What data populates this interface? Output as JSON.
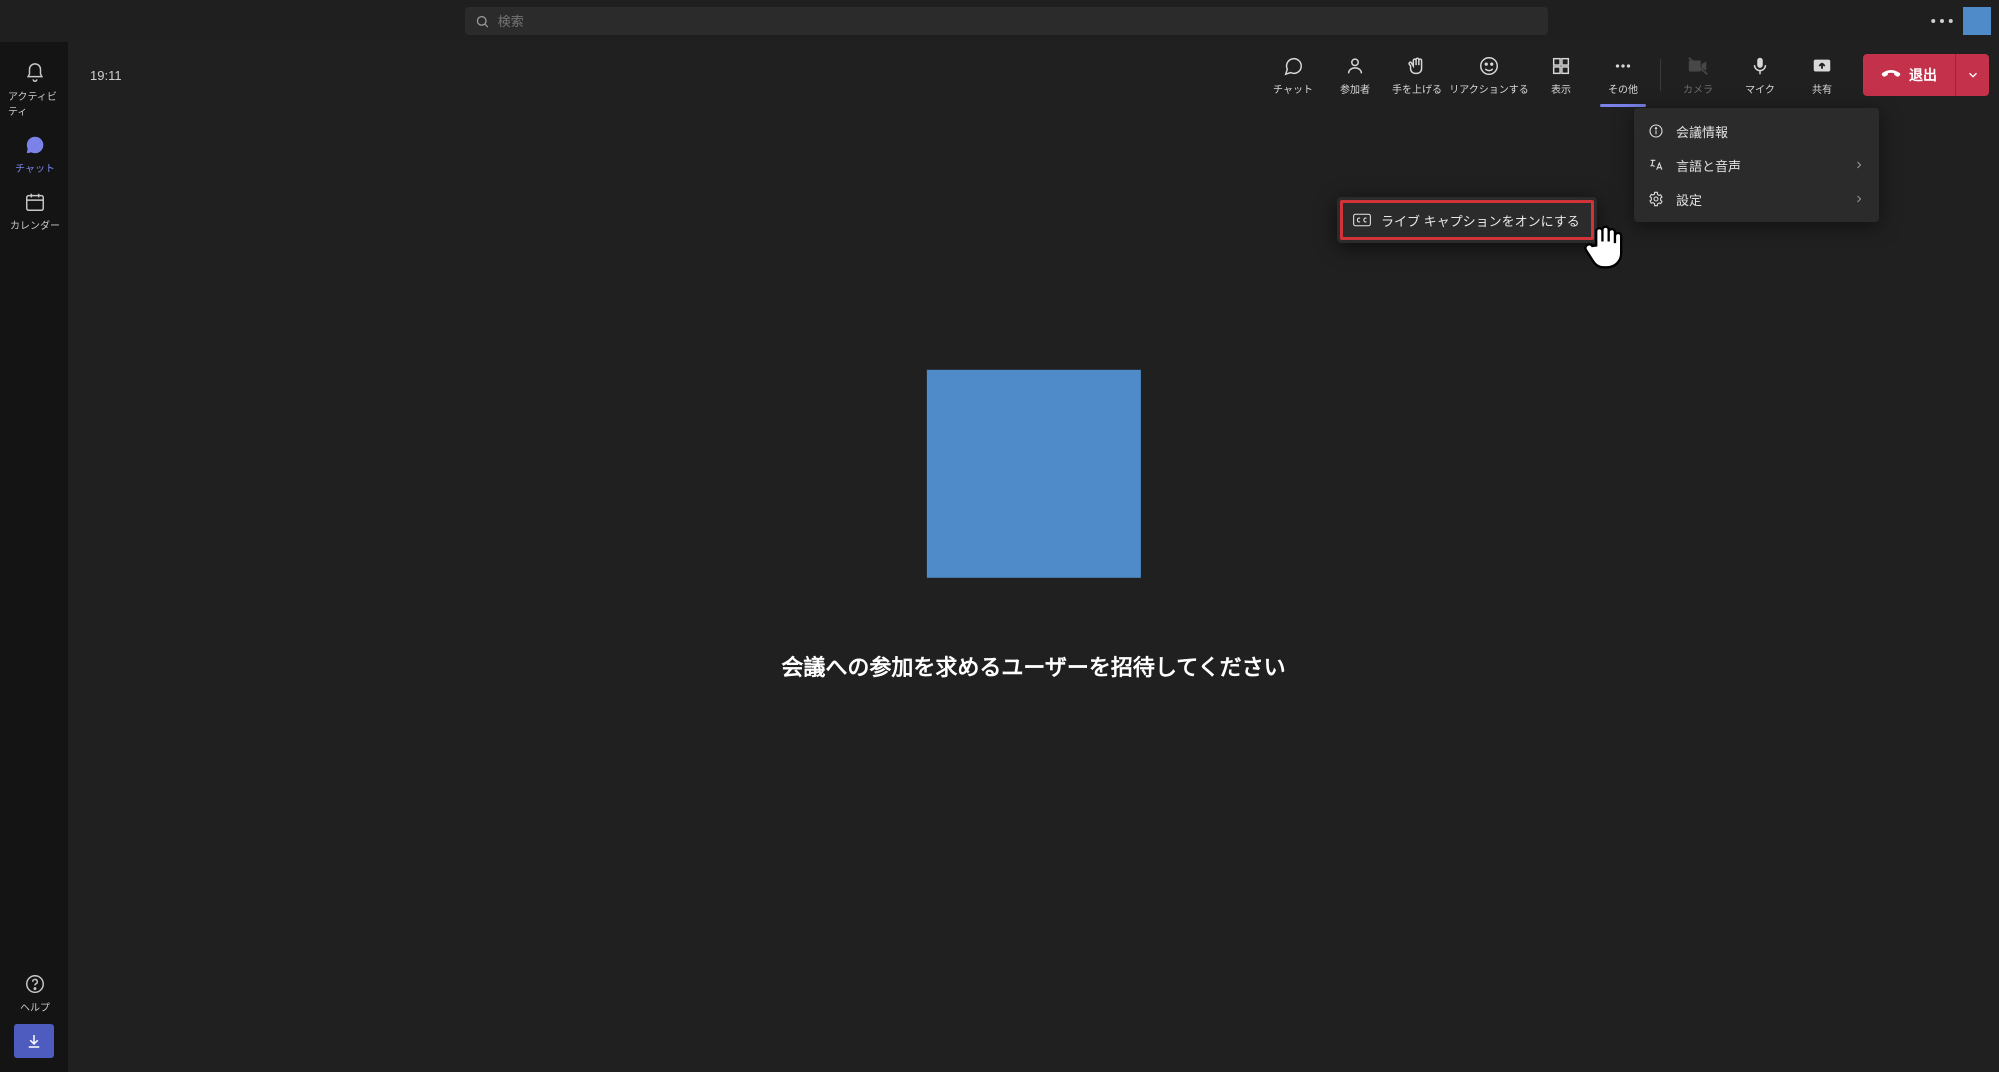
{
  "search": {
    "placeholder": "検索"
  },
  "rail": {
    "activity": "アクティビティ",
    "chat": "チャット",
    "calendar": "カレンダー",
    "help": "ヘルプ"
  },
  "meeting": {
    "time": "19:11",
    "invite_message": "会議への参加を求めるユーザーを招待してください"
  },
  "toolbar": {
    "chat": "チャット",
    "people": "参加者",
    "raise_hand": "手を上げる",
    "react": "リアクションする",
    "view": "表示",
    "more": "その他",
    "camera": "カメラ",
    "mic": "マイク",
    "share": "共有",
    "leave": "退出"
  },
  "more_menu": {
    "info": "会議情報",
    "language": "言語と音声",
    "settings": "設定"
  },
  "callout": {
    "live_captions": "ライブ キャプションをオンにする"
  }
}
